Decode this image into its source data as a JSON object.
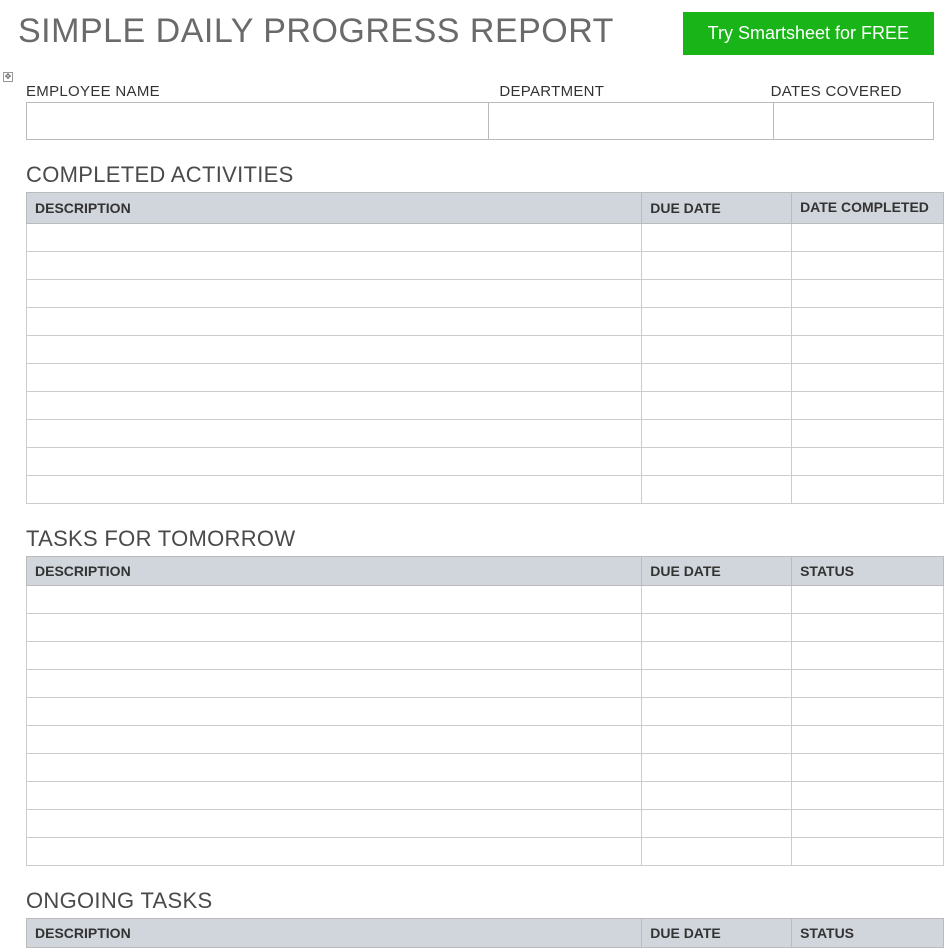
{
  "header": {
    "title": "SIMPLE DAILY PROGRESS REPORT",
    "cta": "Try Smartsheet for FREE"
  },
  "info": {
    "employee_label": "EMPLOYEE NAME",
    "department_label": "DEPARTMENT",
    "dates_label": "DATES COVERED",
    "employee_value": "",
    "department_value": "",
    "dates_value": ""
  },
  "sections": {
    "completed": {
      "title": "COMPLETED ACTIVITIES",
      "columns": {
        "desc": "DESCRIPTION",
        "c2": "DUE DATE",
        "c3": "DATE COMPLETED"
      },
      "rows": [
        {
          "desc": "",
          "c2": "",
          "c3": ""
        },
        {
          "desc": "",
          "c2": "",
          "c3": ""
        },
        {
          "desc": "",
          "c2": "",
          "c3": ""
        },
        {
          "desc": "",
          "c2": "",
          "c3": ""
        },
        {
          "desc": "",
          "c2": "",
          "c3": ""
        },
        {
          "desc": "",
          "c2": "",
          "c3": ""
        },
        {
          "desc": "",
          "c2": "",
          "c3": ""
        },
        {
          "desc": "",
          "c2": "",
          "c3": ""
        },
        {
          "desc": "",
          "c2": "",
          "c3": ""
        },
        {
          "desc": "",
          "c2": "",
          "c3": ""
        }
      ]
    },
    "tomorrow": {
      "title": "TASKS FOR TOMORROW",
      "columns": {
        "desc": "DESCRIPTION",
        "c2": "DUE DATE",
        "c3": "STATUS"
      },
      "rows": [
        {
          "desc": "",
          "c2": "",
          "c3": ""
        },
        {
          "desc": "",
          "c2": "",
          "c3": ""
        },
        {
          "desc": "",
          "c2": "",
          "c3": ""
        },
        {
          "desc": "",
          "c2": "",
          "c3": ""
        },
        {
          "desc": "",
          "c2": "",
          "c3": ""
        },
        {
          "desc": "",
          "c2": "",
          "c3": ""
        },
        {
          "desc": "",
          "c2": "",
          "c3": ""
        },
        {
          "desc": "",
          "c2": "",
          "c3": ""
        },
        {
          "desc": "",
          "c2": "",
          "c3": ""
        },
        {
          "desc": "",
          "c2": "",
          "c3": ""
        }
      ]
    },
    "ongoing": {
      "title": "ONGOING TASKS",
      "columns": {
        "desc": "DESCRIPTION",
        "c2": "DUE DATE",
        "c3": "STATUS"
      },
      "rows": []
    }
  }
}
